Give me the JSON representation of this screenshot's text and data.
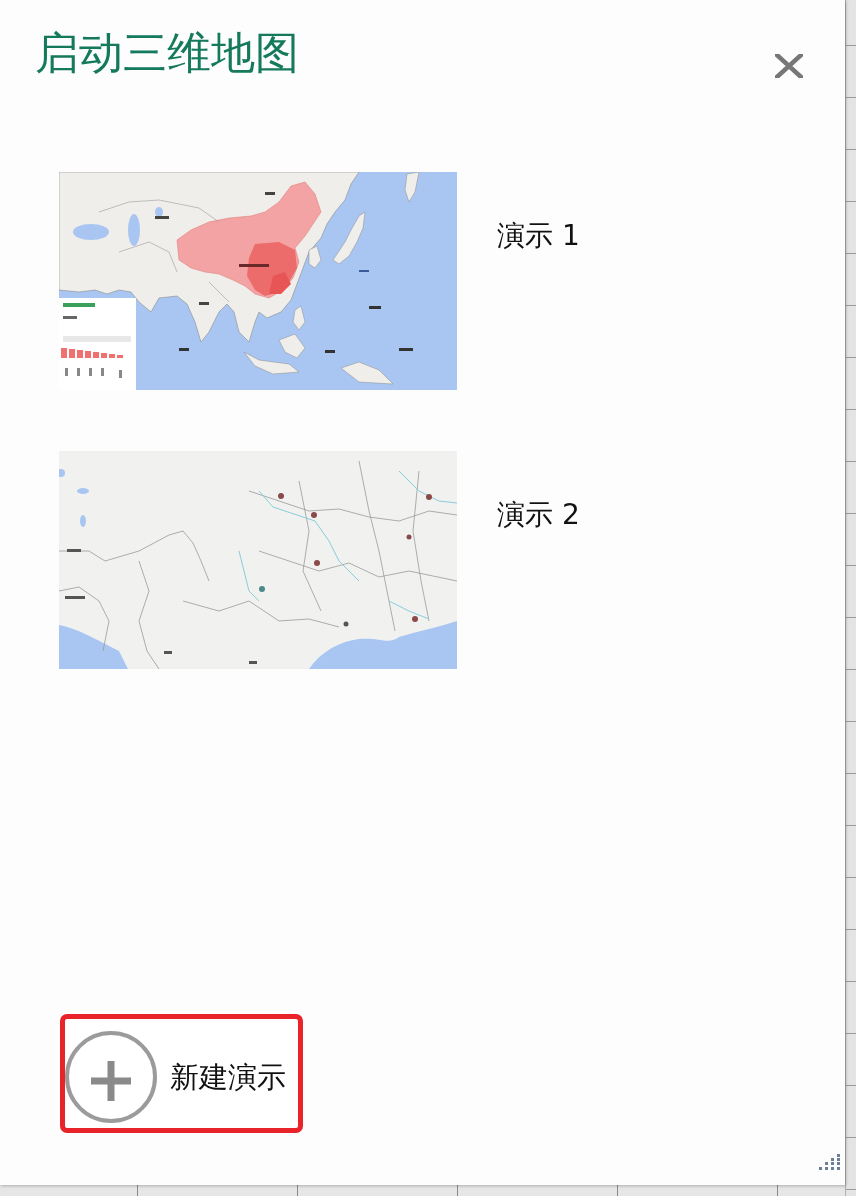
{
  "dialog": {
    "title": "启动三维地图"
  },
  "tours": [
    {
      "label": "演示 1",
      "kind": "continent"
    },
    {
      "label": "演示 2",
      "kind": "region"
    }
  ],
  "new_tour_button": {
    "label": "新建演示",
    "highlighted": true
  }
}
